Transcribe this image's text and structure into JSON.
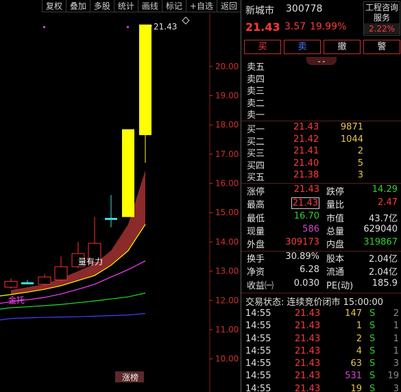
{
  "toolbar": {
    "items": [
      "复权",
      "叠加",
      "多股",
      "统计",
      "画线",
      "标记",
      "+自选",
      "返回"
    ]
  },
  "chart": {
    "price_axis": [
      "20.00",
      "19.00",
      "18.00",
      "17.00",
      "16.00",
      "15.00",
      "14.00",
      "13.00",
      "12.00",
      "11.00",
      "10.00"
    ],
    "high_label": "21.43",
    "annotations": {
      "strong": "量有力",
      "support": "金托",
      "bottom_tag": "涨榜"
    },
    "colors": {
      "up_candle": "#ff3030",
      "limit_up_candle": "#ffff00",
      "band_fill": "#8b2a2a",
      "line_yellow": "#ffff00",
      "line_magenta": "#ff40ff",
      "line_green": "#20e020",
      "line_blue": "#4040ff"
    }
  },
  "chart_data": {
    "type": "candlestick",
    "ylim": [
      9.5,
      21.8
    ],
    "ticks": [
      10,
      11,
      12,
      13,
      14,
      15,
      16,
      17,
      18,
      19,
      20
    ],
    "candles": [
      {
        "open": 12.45,
        "close": 12.65,
        "high": 12.75,
        "low": 12.4,
        "color": "up"
      },
      {
        "open": 12.6,
        "close": 12.62,
        "high": 12.7,
        "low": 12.55,
        "color": "cross"
      },
      {
        "open": 12.55,
        "close": 12.8,
        "high": 12.9,
        "low": 12.5,
        "color": "up"
      },
      {
        "open": 12.7,
        "close": 13.15,
        "high": 13.5,
        "low": 12.65,
        "color": "up"
      },
      {
        "open": 13.15,
        "close": 13.6,
        "high": 14.0,
        "low": 13.1,
        "color": "up"
      },
      {
        "open": 13.3,
        "close": 13.95,
        "high": 14.85,
        "low": 13.25,
        "color": "up"
      },
      {
        "open": 14.8,
        "close": 14.82,
        "high": 15.6,
        "low": 14.5,
        "color": "cross"
      },
      {
        "open": 14.85,
        "close": 17.85,
        "high": 17.85,
        "low": 14.85,
        "color": "limit"
      },
      {
        "open": 17.65,
        "close": 21.43,
        "high": 21.43,
        "low": 16.7,
        "color": "limit"
      }
    ],
    "ma_lines": {
      "band_upper": [
        12.35,
        12.45,
        12.55,
        12.75,
        13.0,
        13.25,
        13.7,
        14.6,
        16.45
      ],
      "band_lower": [
        12.2,
        12.28,
        12.38,
        12.5,
        12.68,
        12.85,
        13.2,
        13.7,
        14.6
      ],
      "yellow": [
        12.2,
        12.28,
        12.38,
        12.5,
        12.68,
        12.85,
        13.2,
        13.7,
        14.6
      ],
      "magenta": [
        11.95,
        12.02,
        12.1,
        12.22,
        12.38,
        12.55,
        12.8,
        13.05,
        13.35
      ],
      "green": [
        11.75,
        11.78,
        11.82,
        11.86,
        11.92,
        11.98,
        12.05,
        12.12,
        12.25
      ],
      "blue": [
        11.38,
        11.4,
        11.42,
        11.43,
        11.44,
        11.46,
        11.48,
        11.5,
        11.55
      ]
    }
  },
  "quote": {
    "name": "新城市",
    "code": "300778",
    "price": "21.43",
    "change": "3.57",
    "change_pct": "19.99%",
    "service_line1": "工程咨询",
    "service_line2": "服务",
    "service_pct": "2.22%",
    "buttons": {
      "buy": "买",
      "sell": "卖",
      "cancel": "撤",
      "alert": "警"
    },
    "collapse_icon": "⌄⌄",
    "asks": [
      {
        "label": "卖五",
        "price": "",
        "vol": ""
      },
      {
        "label": "卖四",
        "price": "",
        "vol": ""
      },
      {
        "label": "卖三",
        "price": "",
        "vol": ""
      },
      {
        "label": "卖二",
        "price": "",
        "vol": ""
      },
      {
        "label": "卖一",
        "price": "",
        "vol": ""
      }
    ],
    "bids": [
      {
        "label": "买一",
        "price": "21.43",
        "vol": "9871"
      },
      {
        "label": "买二",
        "price": "21.42",
        "vol": "1044"
      },
      {
        "label": "买三",
        "price": "21.41",
        "vol": "2"
      },
      {
        "label": "买四",
        "price": "21.40",
        "vol": "5"
      },
      {
        "label": "买五",
        "price": "21.38",
        "vol": "3"
      }
    ],
    "stats1": [
      {
        "k1": "涨停",
        "v1": "21.43",
        "c1": "red",
        "k2": "跌停",
        "v2": "14.29",
        "c2": "green"
      },
      {
        "k1": "最高",
        "v1": "21.43",
        "c1": "red boxed",
        "k2": "量比",
        "v2": "2.47",
        "c2": "red"
      },
      {
        "k1": "最低",
        "v1": "16.70",
        "c1": "green",
        "k2": "市值",
        "v2": "43.7亿",
        "c2": "white"
      },
      {
        "k1": "现量",
        "v1": "586",
        "c1": "purple",
        "k2": "总量",
        "v2": "629040",
        "c2": "white"
      },
      {
        "k1": "外盘",
        "v1": "309173",
        "c1": "red",
        "k2": "内盘",
        "v2": "319867",
        "c2": "green"
      }
    ],
    "stats2": [
      {
        "k1": "换手",
        "v1": "30.89%",
        "c1": "white",
        "k2": "股本",
        "v2": "2.04亿",
        "c2": "white"
      },
      {
        "k1": "净资",
        "v1": "6.28",
        "c1": "white",
        "k2": "流通",
        "v2": "2.04亿",
        "c2": "white"
      },
      {
        "k1": "收益㈠",
        "v1": "0.030",
        "c1": "white",
        "k2": "PE(动)",
        "v2": "185.9",
        "c2": "white"
      }
    ],
    "trade_status": "交易状态: 连续竞价闭市 15:00:00",
    "ticks": [
      {
        "t": "14:55",
        "p": "21.43",
        "v": "147",
        "vc": "",
        "f": "S",
        "n": "2"
      },
      {
        "t": "14:55",
        "p": "21.43",
        "v": "1",
        "vc": "",
        "f": "S",
        "n": "1"
      },
      {
        "t": "14:55",
        "p": "21.43",
        "v": "2",
        "vc": "",
        "f": "S",
        "n": "1"
      },
      {
        "t": "14:55",
        "p": "21.43",
        "v": "4",
        "vc": "",
        "f": "S",
        "n": "1"
      },
      {
        "t": "14:55",
        "p": "21.43",
        "v": "63",
        "vc": "",
        "f": "S",
        "n": "3"
      },
      {
        "t": "14:55",
        "p": "21.43",
        "v": "531",
        "vc": "purple",
        "f": "S",
        "n": "19"
      },
      {
        "t": "14:55",
        "p": "21.43",
        "v": "19",
        "vc": "",
        "f": "S",
        "n": "3"
      }
    ]
  }
}
